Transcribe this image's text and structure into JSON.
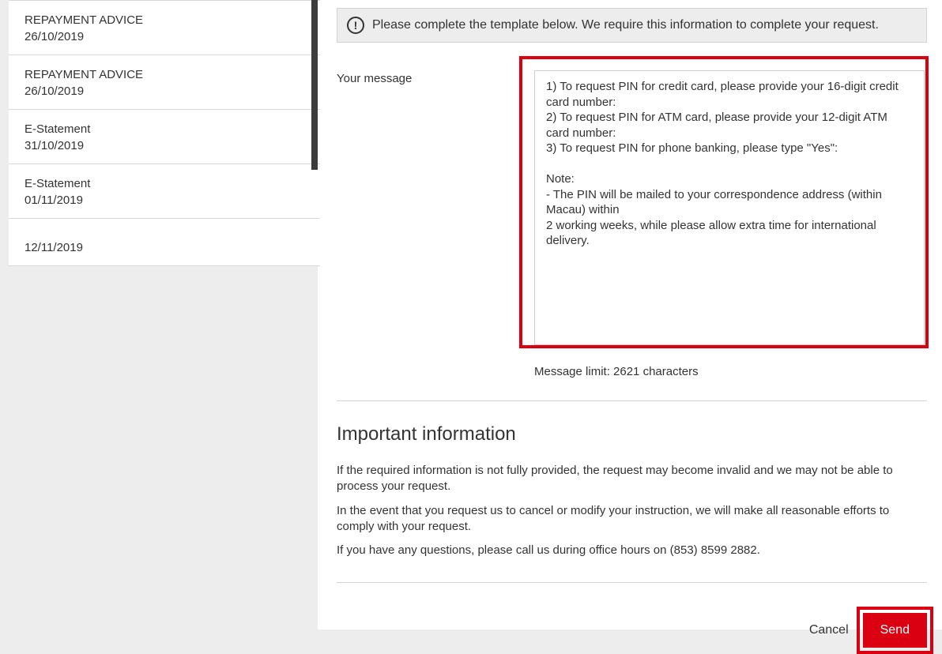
{
  "sidebar": {
    "items": [
      {
        "title": "REPAYMENT ADVICE",
        "date": "26/10/2019"
      },
      {
        "title": "REPAYMENT ADVICE",
        "date": "26/10/2019"
      },
      {
        "title": "E-Statement",
        "date": "31/10/2019"
      },
      {
        "title": "E-Statement",
        "date": "01/11/2019"
      },
      {
        "title": "",
        "date": "12/11/2019"
      }
    ]
  },
  "form": {
    "notice": "Please complete the template below. We require this information to complete your request.",
    "message_label": "Your message",
    "textarea_value": "1) To request PIN for credit card, please provide your 16-digit credit card number:\n2) To request PIN for ATM card, please provide your 12-digit ATM card number:\n3) To request PIN for phone banking, please type \"Yes\":\n\nNote:\n- The PIN will be mailed to your correspondence address (within Macau) within\n2 working weeks, while please allow extra time for international delivery.",
    "char_limit_text": "Message limit: 2621 characters"
  },
  "info": {
    "heading": "Important information",
    "p1": "If the required information is not fully provided, the request may become invalid and we may not be able to process your request.",
    "p2": "In the event that you request us to cancel or modify your instruction, we will make all reasonable efforts to comply with your request.",
    "p3": "If you have any questions, please call us during office hours on (853) 8599 2882."
  },
  "buttons": {
    "cancel": "Cancel",
    "send": "Send"
  }
}
